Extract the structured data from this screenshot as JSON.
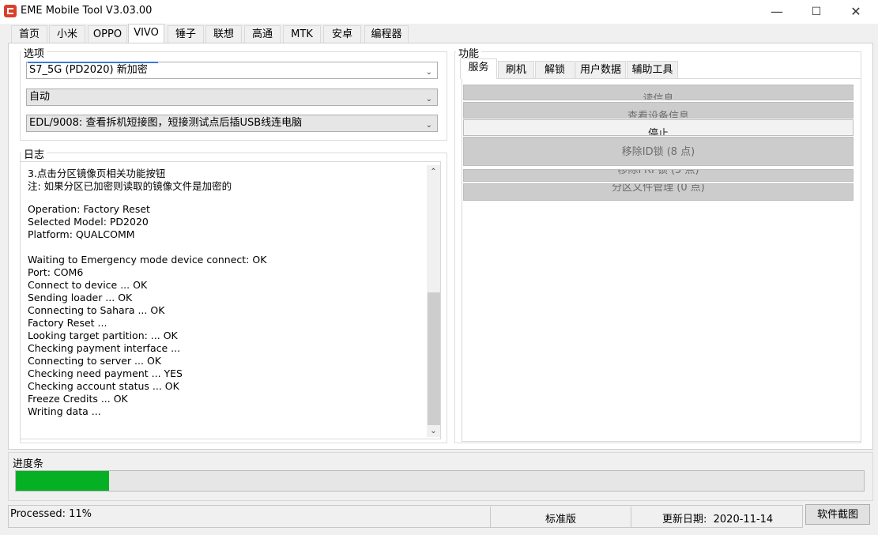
{
  "window": {
    "title": "EME Mobile Tool V3.03.00",
    "minimize": "—",
    "maximize": "☐",
    "close": "✕"
  },
  "tabs": [
    "首页",
    "小米",
    "OPPO",
    "VIVO",
    "锤子",
    "联想",
    "高通",
    "MTK",
    "安卓",
    "编程器"
  ],
  "active_tab": "VIVO",
  "options": {
    "label": "选项",
    "model_select": "S7_5G (PD2020) 新加密",
    "mode_select": "自动",
    "port_select": "EDL/9008: 查看拆机短接图，短接测试点后插USB线连电脑"
  },
  "log": {
    "label": "日志",
    "lines": [
      "3.点击分区镜像页相关功能按钮",
      "注: 如果分区已加密则读取的镜像文件是加密的",
      "",
      "Operation: Factory Reset",
      "Selected Model: PD2020",
      "Platform: QUALCOMM",
      "",
      "Waiting to Emergency mode device connect: OK",
      "Port: COM6",
      "Connect to device ... OK",
      "Sending loader ... OK",
      "Connecting to Sahara ... OK",
      "Factory Reset ...",
      "Looking target partition: ... OK",
      "Checking payment interface ...",
      "Connecting to server ... OK",
      "Checking need payment ... YES",
      "Checking account status ... OK",
      "Freeze Credits ... OK",
      "Writing data ..."
    ]
  },
  "functions": {
    "label": "功能",
    "tabs": [
      "服务",
      "刷机",
      "解锁",
      "用户数据",
      "辅助工具"
    ],
    "active_tab": "服务",
    "buttons": [
      "读信息",
      "查看设备信息",
      "停止",
      "移除ID锁 (8 点)",
      "移除FRP锁 (5 点)",
      "分区文件管理 (0 点)"
    ]
  },
  "progress": {
    "label": "进度条",
    "percent": 11,
    "fill_color": "#06b025"
  },
  "status": {
    "processed": "Processed: 11%",
    "edition": "标准版",
    "update_date": "更新日期:  2020-11-14",
    "screenshot_button": "软件截图"
  }
}
